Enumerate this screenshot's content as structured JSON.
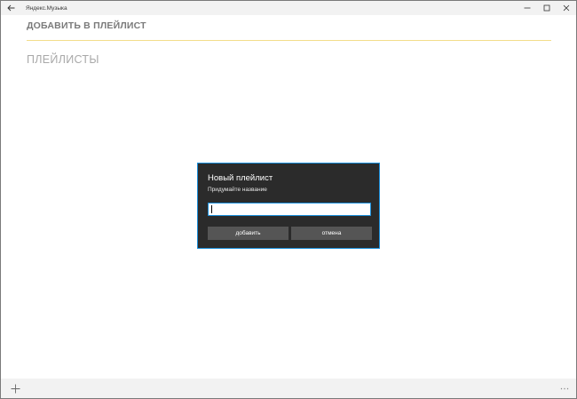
{
  "window": {
    "app_title": "Яндекс.Музыка"
  },
  "page": {
    "title": "ДОБАВИТЬ В ПЛЕЙЛИСТ",
    "section_title": "ПЛЕЙЛИСТЫ"
  },
  "dialog": {
    "title": "Новый плейлист",
    "subtitle": "Придумайте название",
    "input_value": "",
    "add_label": "добавить",
    "cancel_label": "отмена"
  },
  "icons": {
    "back": "arrow-left-icon",
    "minimize": "minimize-icon",
    "maximize": "maximize-icon",
    "close": "close-icon",
    "add": "plus-icon",
    "more": "ellipsis-icon"
  },
  "colors": {
    "accent": "#1a8fdb",
    "title_underline": "#f3dd8a",
    "dialog_background": "#2b2b2b",
    "dialog_button": "#555555"
  }
}
